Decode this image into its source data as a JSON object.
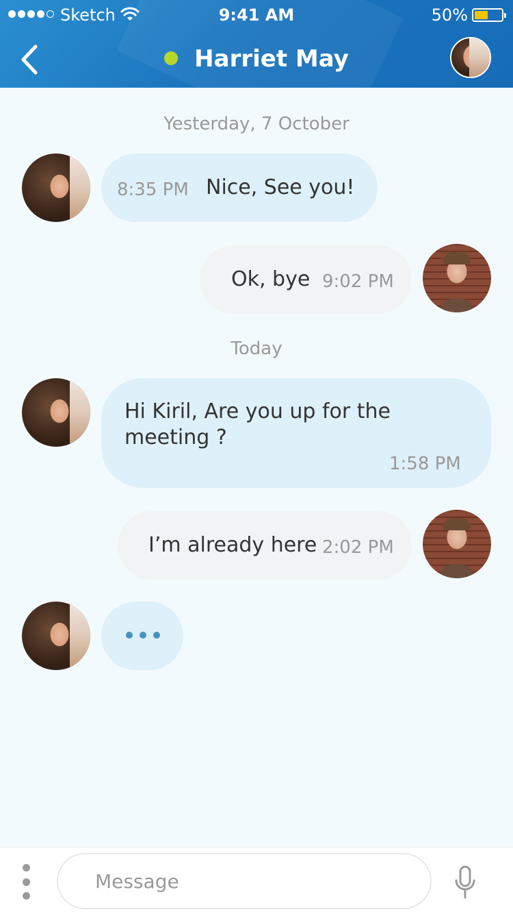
{
  "status_bar": {
    "carrier": "Sketch",
    "time": "9:41 AM",
    "battery_percent": "50%",
    "battery_level": 0.5,
    "signal_bars_filled": 4,
    "signal_bars_total": 5
  },
  "header": {
    "contact_name": "Harriet May",
    "online_color": "#b6d82c",
    "accent_color": "#1a73bd"
  },
  "conversation": {
    "separators": [
      "Yesterday, 7 October",
      "Today"
    ],
    "messages": [
      {
        "direction": "incoming",
        "time": "8:35 PM",
        "text": "Nice, See you!"
      },
      {
        "direction": "outgoing",
        "text": "Ok, bye",
        "time": "9:02 PM"
      },
      {
        "direction": "incoming",
        "text": "Hi Kiril, Are you up for the meeting ?",
        "time": "1:58 PM"
      },
      {
        "direction": "outgoing",
        "text": "I’m already here",
        "time": "2:02 PM"
      }
    ],
    "typing_indicator": true
  },
  "input_bar": {
    "placeholder": "Message",
    "value": ""
  },
  "icons": {
    "back": "chevron-left-icon",
    "menu": "vertical-dots-icon",
    "mic": "microphone-icon",
    "wifi": "wifi-icon"
  }
}
